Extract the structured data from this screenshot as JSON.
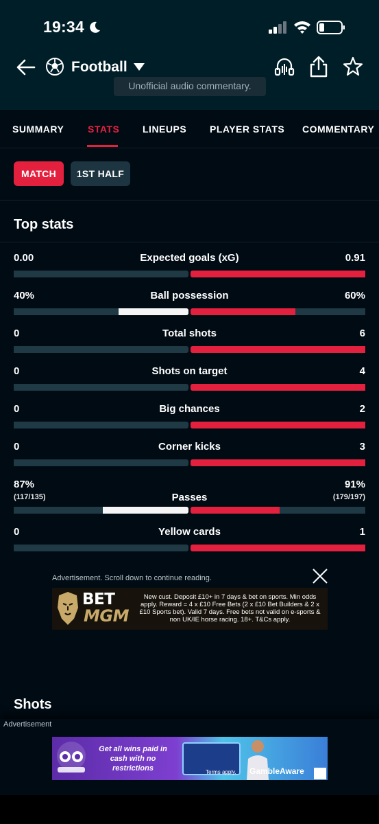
{
  "status_bar": {
    "time": "19:34"
  },
  "header": {
    "title": "Football",
    "audio_commentary": "Unofficial audio commentary."
  },
  "tabs": [
    {
      "label": "SUMMARY",
      "active": false
    },
    {
      "label": "STATS",
      "active": true
    },
    {
      "label": "LINEUPS",
      "active": false
    },
    {
      "label": "PLAYER STATS",
      "active": false
    },
    {
      "label": "COMMENTARY",
      "active": false
    }
  ],
  "periods": {
    "match": "MATCH",
    "first_half": "1ST HALF"
  },
  "top_stats": {
    "title": "Top stats",
    "rows": [
      {
        "name": "Expected goals (xG)",
        "left": "0.00",
        "right": "0.91",
        "left_share": 0.0,
        "right_share": 1.0
      },
      {
        "name": "Ball possession",
        "left": "40%",
        "right": "60%",
        "left_share": 0.4,
        "right_share": 0.6
      },
      {
        "name": "Total shots",
        "left": "0",
        "right": "6",
        "left_share": 0.0,
        "right_share": 1.0
      },
      {
        "name": "Shots on target",
        "left": "0",
        "right": "4",
        "left_share": 0.0,
        "right_share": 1.0
      },
      {
        "name": "Big chances",
        "left": "0",
        "right": "2",
        "left_share": 0.0,
        "right_share": 1.0
      },
      {
        "name": "Corner kicks",
        "left": "0",
        "right": "3",
        "left_share": 0.0,
        "right_share": 1.0
      },
      {
        "name": "Passes",
        "left": "87%",
        "right": "91%",
        "left_sub": "(117/135)",
        "right_sub": "(179/197)",
        "left_share": 0.49,
        "right_share": 0.51
      },
      {
        "name": "Yellow cards",
        "left": "0",
        "right": "1",
        "left_share": 0.0,
        "right_share": 1.0
      }
    ]
  },
  "ad_top": {
    "note": "Advertisement. Scroll down to continue reading.",
    "brand_top": "BET",
    "brand_bottom": "MGM",
    "text": "New cust. Deposit £10+ in 7 days & bet on sports. Min odds apply. Reward = 4 x £10 Free Bets (2 x £10 Bet Builders & 2 x £10 Sports bet). Valid 7 days. Free bets not valid on e-sports & non UK/IE horse racing. 18+. T&Cs apply."
  },
  "shots_title": "Shots",
  "ad_bottom": {
    "note": "Advertisement",
    "text": "Get all wins paid in cash with no restrictions",
    "terms": "Terms apply.",
    "gamble_aware": "GambleAware"
  },
  "colors": {
    "accent": "#e3203e",
    "home_bar": "#f5f5f5",
    "track": "#1f3a44",
    "header_bg": "#001e28",
    "page_bg": "#010b14"
  }
}
